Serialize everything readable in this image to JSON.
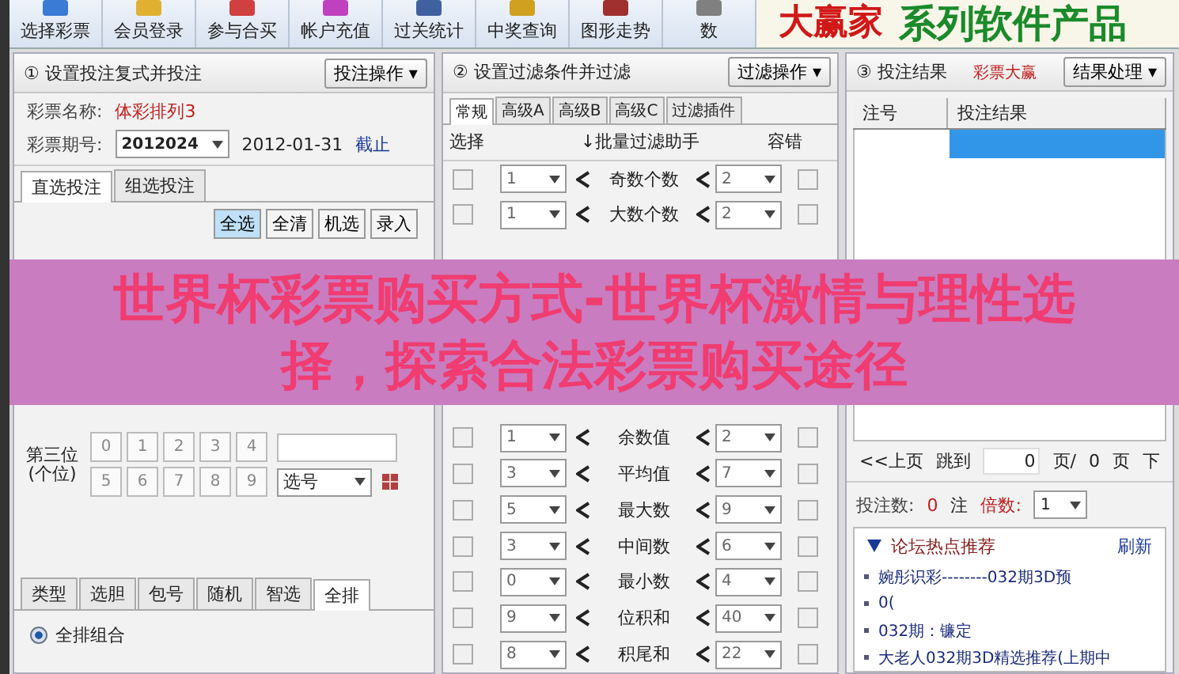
{
  "toolbar": {
    "items": [
      {
        "label": "选择彩票"
      },
      {
        "label": "会员登录"
      },
      {
        "label": "参与合买"
      },
      {
        "label": "帐户充值"
      },
      {
        "label": "过关统计"
      },
      {
        "label": "中奖查询"
      },
      {
        "label": "图形走势"
      },
      {
        "label": "数"
      }
    ]
  },
  "logo": {
    "brand": "大赢家",
    "tagline": "系列软件产品"
  },
  "bet_panel": {
    "title": "① 设置投注复式并投注",
    "menu_button": "投注操作 ▾",
    "name_label": "彩票名称:",
    "name_value": "体彩排列3",
    "issue_label": "彩票期号:",
    "issue_value": "2012024",
    "issue_date": "2012-01-31",
    "issue_deadline": "截止",
    "tabs": [
      {
        "label": "直选投注",
        "selected": true
      },
      {
        "label": "组选投注",
        "selected": false
      }
    ],
    "buttons": [
      {
        "label": "全选",
        "highlighted": true
      },
      {
        "label": "全清",
        "highlighted": false
      },
      {
        "label": "机选",
        "highlighted": false
      },
      {
        "label": "录入",
        "highlighted": false
      }
    ],
    "positions": [
      {
        "label": "第三位",
        "sub": "(个位)",
        "digits": [
          "0",
          "1",
          "2",
          "3",
          "4",
          "5",
          "6",
          "7",
          "8",
          "9"
        ],
        "select": "选号"
      }
    ],
    "bottom_tabs": [
      {
        "label": "类型",
        "selected": false
      },
      {
        "label": "选胆",
        "selected": false
      },
      {
        "label": "包号",
        "selected": false
      },
      {
        "label": "随机",
        "selected": false
      },
      {
        "label": "智选",
        "selected": false
      },
      {
        "label": "全排",
        "selected": true
      }
    ],
    "radio": {
      "label": "全排组合",
      "checked": true
    }
  },
  "filter_panel": {
    "title": "② 设置过滤条件并过滤",
    "menu_button": "过滤操作 ▾",
    "tabs": [
      {
        "label": "常规",
        "selected": true
      },
      {
        "label": "高级A",
        "selected": false
      },
      {
        "label": "高级B",
        "selected": false
      },
      {
        "label": "高级C",
        "selected": false
      },
      {
        "label": "过滤插件",
        "selected": false
      }
    ],
    "columns": [
      "选择",
      "↓批量过滤助手",
      "容错"
    ],
    "rows_top": [
      {
        "checked": false,
        "min": "1",
        "name": "奇数个数",
        "max": "2",
        "tolerance": false
      },
      {
        "checked": false,
        "min": "1",
        "name": "大数个数",
        "max": "2",
        "tolerance": false
      }
    ],
    "rows_bottom": [
      {
        "checked": false,
        "min": "1",
        "name": "余数值",
        "max": "2",
        "tolerance": false
      },
      {
        "checked": false,
        "min": "3",
        "name": "平均值",
        "max": "7",
        "tolerance": false
      },
      {
        "checked": false,
        "min": "5",
        "name": "最大数",
        "max": "9",
        "tolerance": false
      },
      {
        "checked": false,
        "min": "3",
        "name": "中间数",
        "max": "6",
        "tolerance": false
      },
      {
        "checked": false,
        "min": "0",
        "name": "最小数",
        "max": "4",
        "tolerance": false
      },
      {
        "checked": false,
        "min": "9",
        "name": "位积和",
        "max": "40",
        "tolerance": false
      },
      {
        "checked": false,
        "min": "8",
        "name": "积尾和",
        "max": "22",
        "tolerance": false
      }
    ]
  },
  "result_panel": {
    "title": "③ 投注结果",
    "notice": "彩票大赢",
    "menu_button": "结果处理 ▾",
    "columns": [
      "注号",
      "投注结果"
    ],
    "rows": [
      {
        "selected": true
      }
    ],
    "pager": {
      "prev": "<<上页",
      "jump": "跳到",
      "page": "0",
      "page_of": "页/",
      "total": "0",
      "page_unit": "页",
      "next": "下"
    },
    "bet_count_label": "投注数:",
    "bet_count": "0",
    "bet_unit": "注",
    "multiple_label": "倍数:",
    "multiple": "1",
    "forum": {
      "title": "论坛热点推荐",
      "refresh": "刷新",
      "expanded": true,
      "items": [
        "婉彤识彩--------032期3D预",
        "0(",
        "032期：镰定",
        "大老人032期3D精选推荐(上期中"
      ]
    }
  },
  "banner": {
    "text": "世界杯彩票购买方式-世界杯激情与理性选择，探索合法彩票购买途径"
  }
}
